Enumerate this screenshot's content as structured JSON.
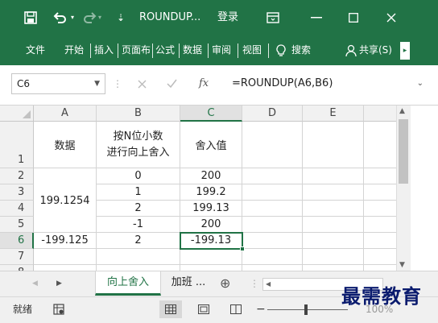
{
  "titlebar": {
    "filename": "ROUNDUP...",
    "login": "登录",
    "bg_color": "#217346"
  },
  "ribbon": {
    "tabs": [
      "文件",
      "开始",
      "插入",
      "页面布",
      "公式",
      "数据",
      "审阅",
      "视图"
    ],
    "search": "搜索",
    "share": "共享(S)"
  },
  "formula_bar": {
    "name_box": "C6",
    "fx_label": "fx",
    "formula": "=ROUNDUP(A6,B6)"
  },
  "grid": {
    "columns": [
      "A",
      "B",
      "C",
      "D",
      "E"
    ],
    "rows": [
      "1",
      "2",
      "3",
      "4",
      "5",
      "6",
      "7",
      "8"
    ],
    "header_a": "数据",
    "header_b_line1": "按N位小数",
    "header_b_line2": "进行向上舍入",
    "header_c": "舍入值",
    "a_merged_3_4": "199.1254",
    "a6": "-199.125",
    "b_values": [
      "0",
      "1",
      "2",
      "-1",
      "2"
    ],
    "c_values": [
      "200",
      "199.2",
      "199.13",
      "200",
      "-199.13"
    ],
    "selected_cell": "C6"
  },
  "sheets": {
    "active": "向上舍入",
    "other": "加班 ...",
    "add_symbol": "⊕"
  },
  "statusbar": {
    "ready": "就绪",
    "zoom": "100%"
  },
  "watermark": "最需教育"
}
